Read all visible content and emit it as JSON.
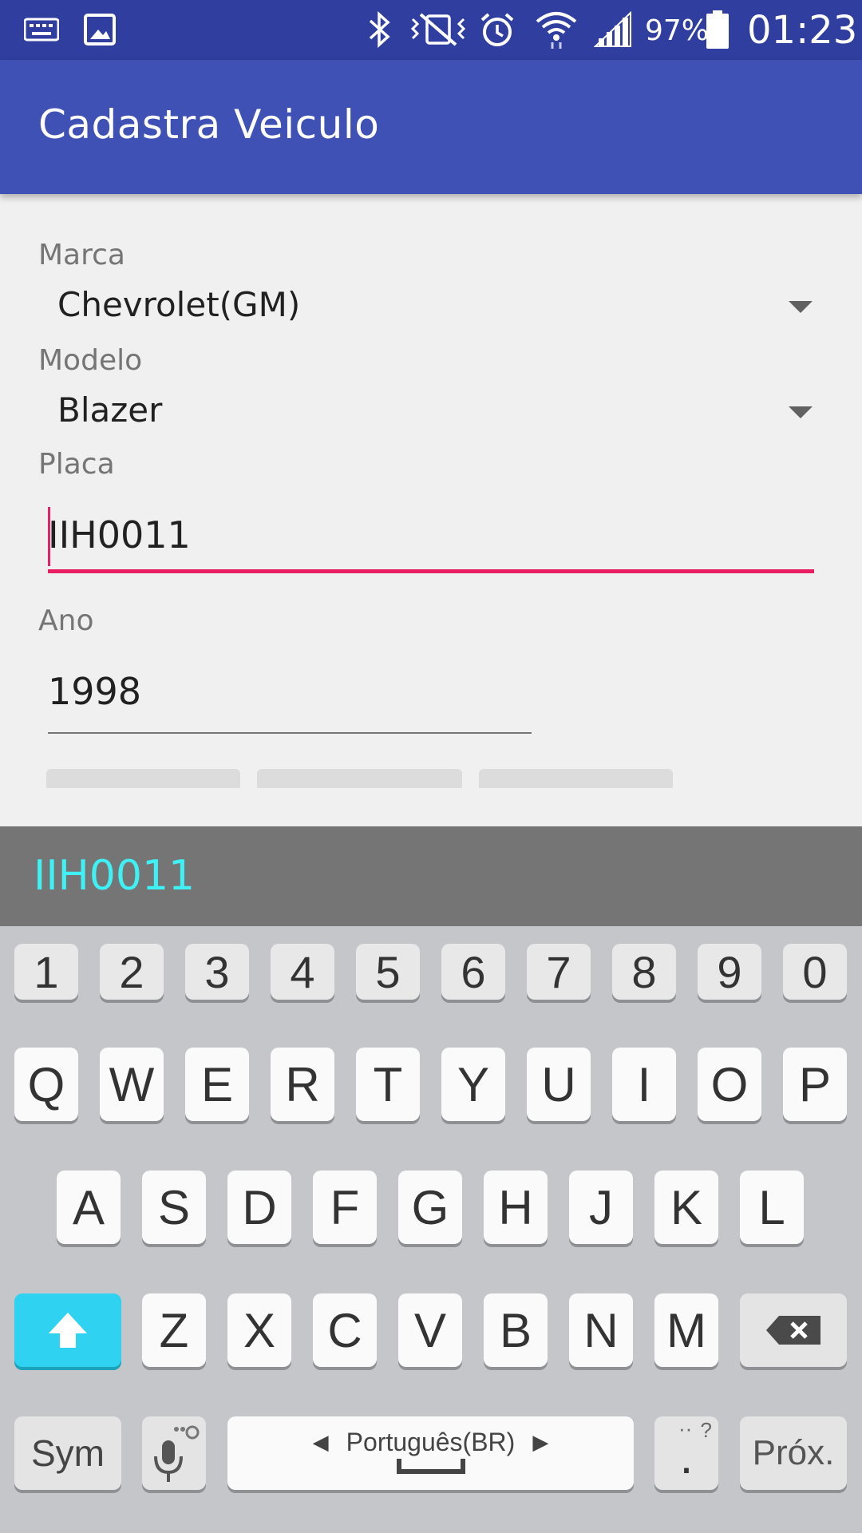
{
  "status_bar": {
    "battery_percent": "97%",
    "time": "01:23",
    "icons": [
      "keyboard-icon",
      "image-icon",
      "bluetooth-icon",
      "vibrate-mute-icon",
      "alarm-icon",
      "wifi-icon",
      "signal-icon",
      "battery-icon"
    ]
  },
  "app_bar": {
    "title": "Cadastra Veiculo"
  },
  "form": {
    "marca": {
      "label": "Marca",
      "value": "Chevrolet(GM)"
    },
    "modelo": {
      "label": "Modelo",
      "value": "Blazer"
    },
    "placa": {
      "label": "Placa",
      "value": "IIH0011"
    },
    "ano": {
      "label": "Ano",
      "value": "1998"
    }
  },
  "colors": {
    "status_bar": "#303f9f",
    "app_bar": "#3f51b5",
    "accent": "#e91e63",
    "shift": "#2fd2f0",
    "suggestion": "#3ff0f5"
  },
  "keyboard": {
    "suggestion": "IIH0011",
    "number_row": [
      "1",
      "2",
      "3",
      "4",
      "5",
      "6",
      "7",
      "8",
      "9",
      "0"
    ],
    "row1": [
      "Q",
      "W",
      "E",
      "R",
      "T",
      "Y",
      "U",
      "I",
      "O",
      "P"
    ],
    "row2": [
      "A",
      "S",
      "D",
      "F",
      "G",
      "H",
      "J",
      "K",
      "L"
    ],
    "row3": [
      "Z",
      "X",
      "C",
      "V",
      "B",
      "N",
      "M"
    ],
    "sym_label": "Sym",
    "language_label": "Português(BR)",
    "period_label": ".",
    "period_hint": "?",
    "next_label": "Próx."
  }
}
